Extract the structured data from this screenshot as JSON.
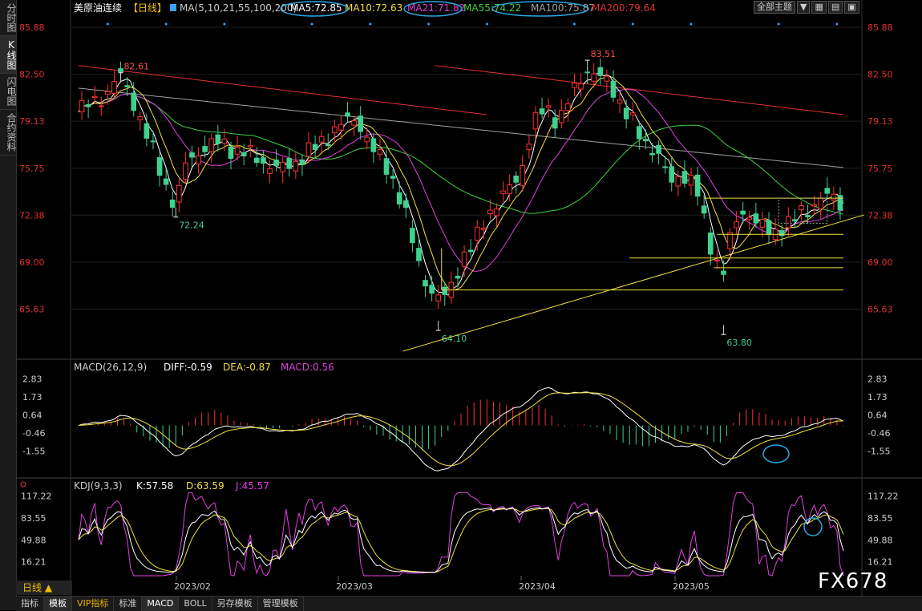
{
  "sidebar": {
    "tabs": [
      "分时图",
      "K线图",
      "闪电图",
      "合约资料"
    ],
    "active": 1
  },
  "header": {
    "instrument": "美原油连续",
    "period": "【日线】",
    "ma_label": "MA(5,10,21,55,100,200)",
    "ma_values": [
      {
        "text": "MA5:72.85",
        "color": "#ffffff"
      },
      {
        "text": "MA10:72.63",
        "color": "#f0e040"
      },
      {
        "text": "MA21:71.82",
        "color": "#e040e0"
      },
      {
        "text": "MA55:74.22",
        "color": "#40d040"
      },
      {
        "text": "MA100:75.87",
        "color": "#a0a0a0"
      },
      {
        "text": "MA200:79.64",
        "color": "#e03030"
      }
    ],
    "theme_button": "全部主题"
  },
  "macd_header": {
    "label": "MACD(26,12,9)",
    "diff": "DIFF:-0.59",
    "dea": "DEA:-0.87",
    "macd": "MACD:0.56"
  },
  "kdj_header": {
    "label": "KDJ(9,3,3)",
    "k": "K:57.58",
    "d": "D:63.59",
    "j": "J:45.57"
  },
  "bottom": {
    "day_label": "日线 ▲",
    "tabs": [
      "指标",
      "模板",
      "VIP指标",
      "标准",
      "MACD",
      "BOLL",
      "另存模板",
      "管理模板"
    ]
  },
  "watermark": "FX678",
  "colors": {
    "up": "#ff3030",
    "down": "#40d090",
    "ma5": "#ffffff",
    "ma10": "#f0e040",
    "ma21": "#e040e0",
    "ma55": "#40d040",
    "ma100": "#a0a0a0",
    "ma200": "#e03030",
    "trend": "#f0e040",
    "circle": "#2aa8e0"
  },
  "chart_data": {
    "type": "candlestick",
    "price_axis_ticks": [
      85.88,
      82.5,
      79.13,
      75.75,
      72.38,
      69.0,
      65.63
    ],
    "price_range": [
      62.2,
      86.8
    ],
    "annotations": [
      {
        "label": "82.61",
        "value": 82.61,
        "kind": "high"
      },
      {
        "label": "72.24",
        "value": 72.24,
        "kind": "low"
      },
      {
        "label": "64.10",
        "value": 64.1,
        "kind": "low"
      },
      {
        "label": "83.51",
        "value": 83.51,
        "kind": "high"
      },
      {
        "label": "63.80",
        "value": 63.8,
        "kind": "low"
      }
    ],
    "x_axis_labels": [
      "2023/02",
      "2023/03",
      "2023/04",
      "2023/05"
    ],
    "macd_axis_ticks": [
      2.83,
      1.73,
      0.64,
      -0.46,
      -1.55
    ],
    "macd_range": [
      -2.9,
      3.2
    ],
    "kdj_axis_ticks": [
      117.22,
      83.55,
      49.88,
      16.21
    ],
    "kdj_range": [
      -5,
      125
    ],
    "horizontal_levels": [
      73.6,
      71.0,
      69.3,
      68.6,
      67.0
    ]
  }
}
